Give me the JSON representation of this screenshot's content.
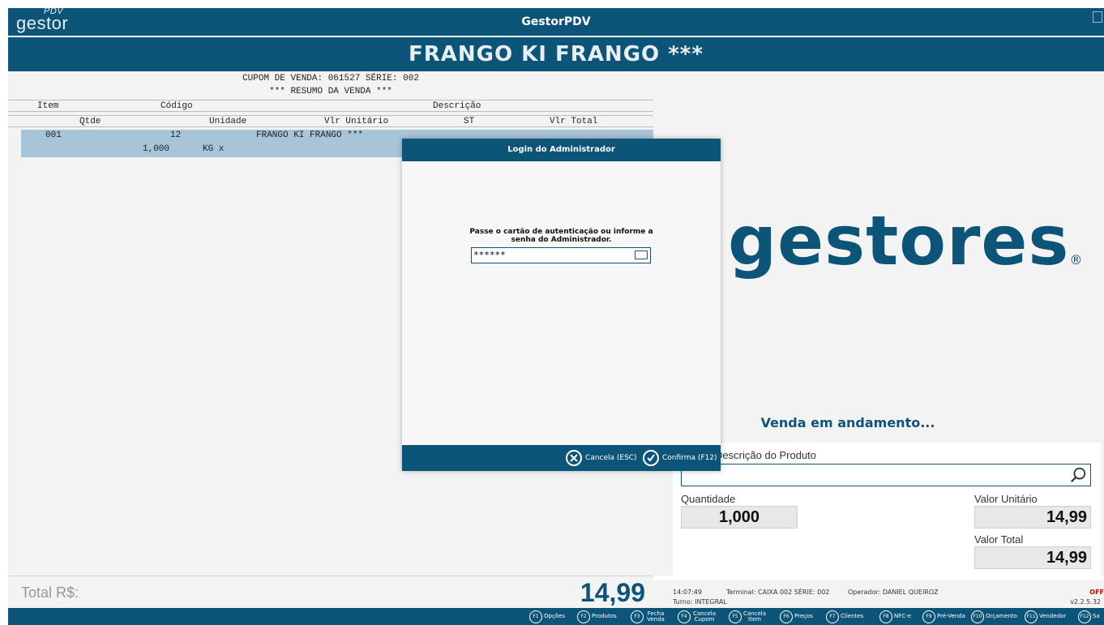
{
  "header": {
    "logo": "gestor",
    "logo_sup": "PDV",
    "title": "GestorPDV"
  },
  "banner": {
    "product": "FRANGO KI FRANGO ***"
  },
  "cupom": {
    "line1": "CUPOM DE VENDA: 061527  SÉRIE: 002",
    "line2": "*** RESUMO DA VENDA ***",
    "headers1": {
      "item": "Item",
      "codigo": "Código",
      "descricao": "Descrição"
    },
    "headers2": {
      "qtde": "Qtde",
      "unidade": "Unidade",
      "vlr_unitario": "Vlr Unitário",
      "st": "ST",
      "vlr_total": "Vlr Total"
    },
    "rows": [
      {
        "item": "001",
        "codigo": "12",
        "descricao": "FRANGO KI FRANGO ***",
        "qtde": "1,000",
        "unidade": "KG x"
      }
    ]
  },
  "brand": {
    "name": "gestores",
    "reg": "®"
  },
  "status_text": "Venda em andamento...",
  "product_panel": {
    "descricao_label": "Descrição do Produto",
    "quantidade_label": "Quantidade",
    "quantidade": "1,000",
    "valor_unitario_label": "Valor Unitário",
    "valor_unitario": "14,99",
    "valor_total_label": "Valor Total",
    "valor_total": "14,99"
  },
  "total": {
    "label": "Total R$:",
    "value": "14,99"
  },
  "status_bar": {
    "time": "14:07:49",
    "terminal": "Terminal: CAIXA 002  SÉRIE: 002",
    "operador": "Operador: DANIEL QUEIROZ",
    "turno": "Turno: INTEGRAL",
    "off": "OFF",
    "version": "v2.2.5.32"
  },
  "fkeys": [
    {
      "key": "F1",
      "label": "Opções"
    },
    {
      "key": "F2",
      "label": "Produtos"
    },
    {
      "key": "F3",
      "label": "Fecha Venda"
    },
    {
      "key": "F4",
      "label": "Cancela Cupom"
    },
    {
      "key": "F5",
      "label": "Cancela Item"
    },
    {
      "key": "F6",
      "label": "Preços"
    },
    {
      "key": "F7",
      "label": "Clientes"
    },
    {
      "key": "F8",
      "label": "NFC-e"
    },
    {
      "key": "F9",
      "label": "Pré-Venda"
    },
    {
      "key": "F10",
      "label": "Orçamento"
    },
    {
      "key": "F11",
      "label": "Vendedor"
    },
    {
      "key": "F12",
      "label": "Sa"
    }
  ],
  "modal": {
    "title": "Login do Administrador",
    "message_line1": "Passe o cartão de autenticação ou informe a",
    "message_line2": "senha do Administrador.",
    "password_value": "******",
    "cancel_label": "Cancela (ESC)",
    "confirm_label": "Confirma (F12)"
  },
  "colors": {
    "primary": "#0d5479",
    "row_highlight": "#a8c4d8",
    "off": "#cc0000"
  }
}
